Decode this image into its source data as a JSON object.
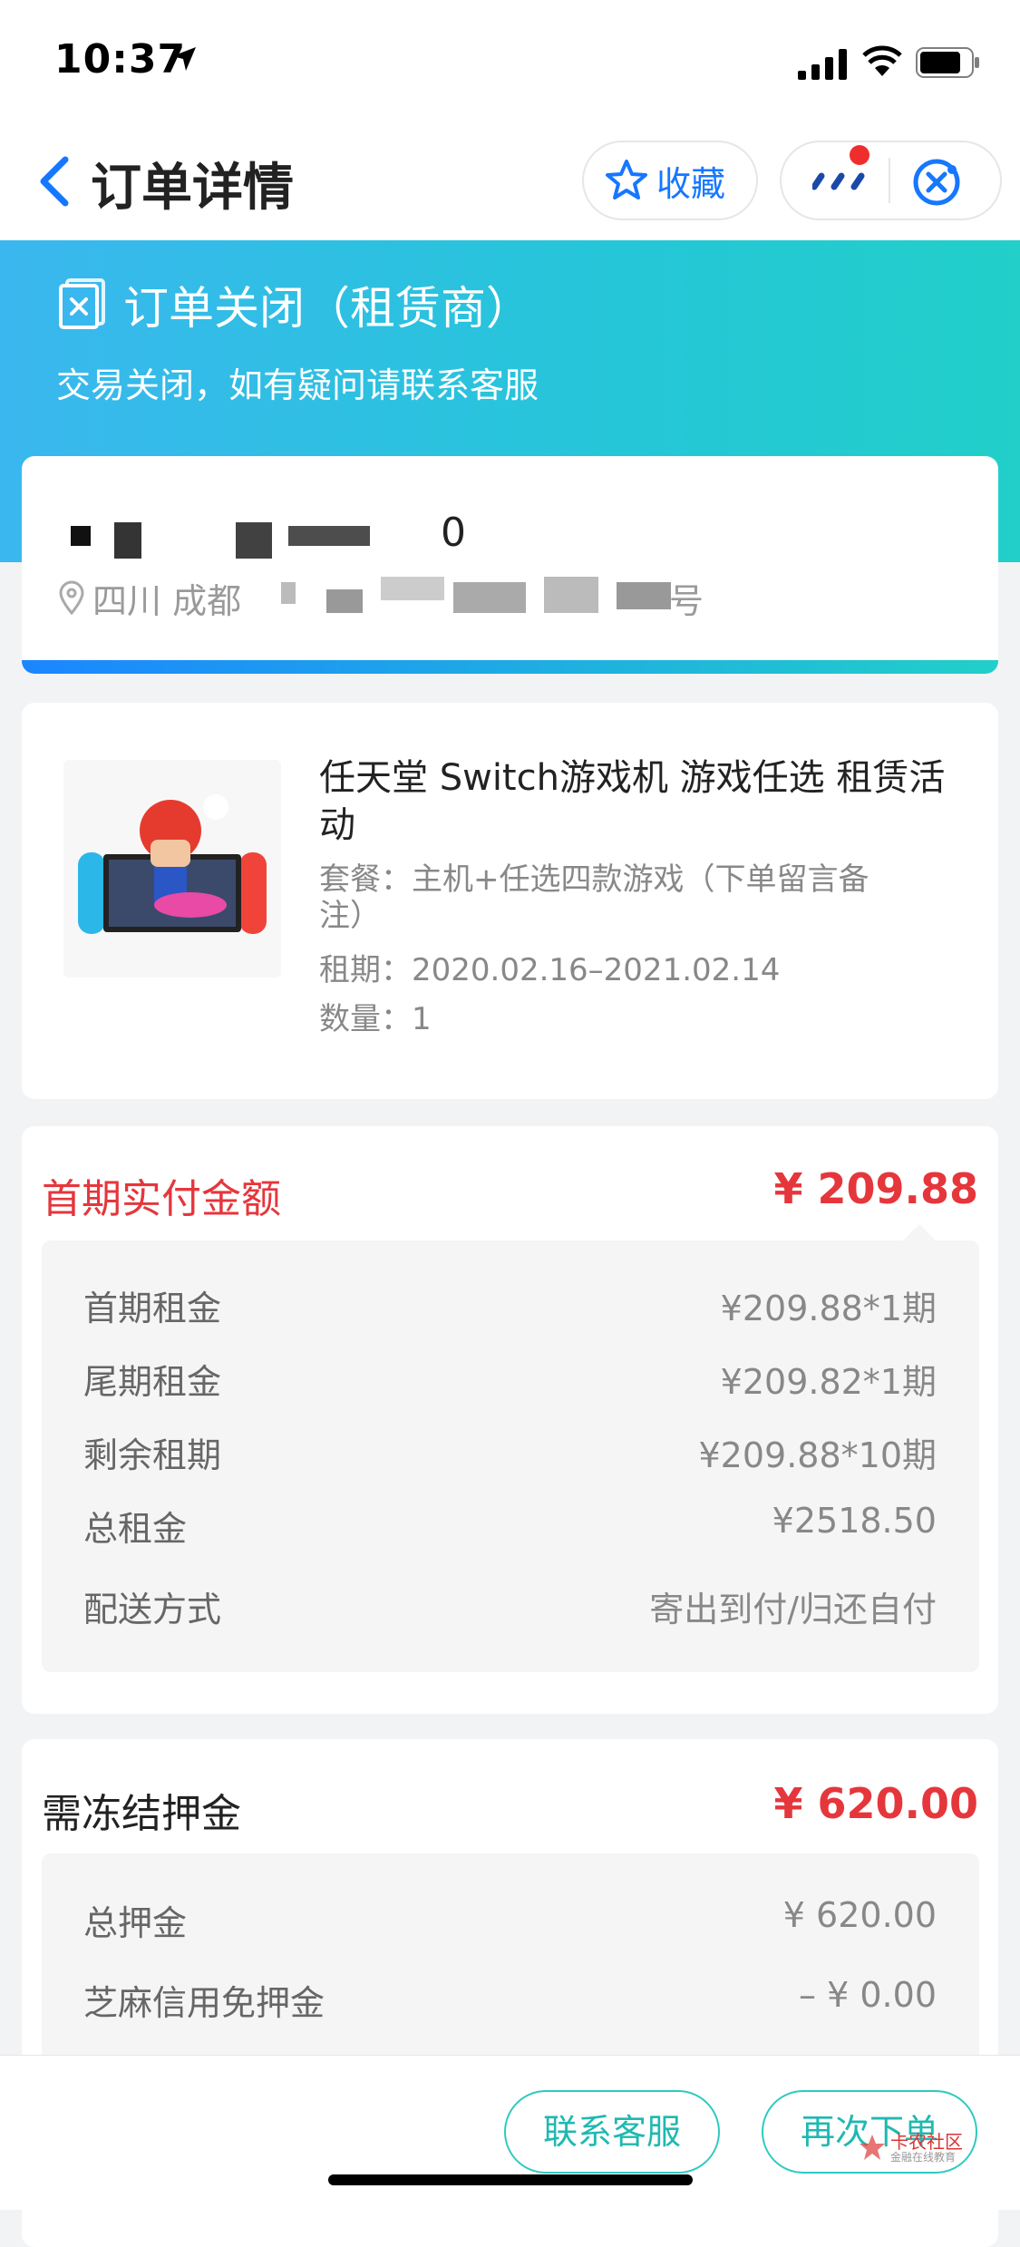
{
  "status_bar": {
    "time": "10:37"
  },
  "nav": {
    "title": "订单详情",
    "favorite_label": "收藏"
  },
  "banner": {
    "title": "订单关闭（租赁商）",
    "subtitle": "交易关闭，如有疑问请联系客服"
  },
  "address": {
    "name_suffix": "0",
    "region": "四川 成都",
    "tail": "号"
  },
  "product": {
    "title": "任天堂 Switch游戏机 游戏任选 租赁活动",
    "package": "套餐：主机+任选四款游戏（下单留言备注）",
    "period": "租期：2020.02.16–2021.02.14",
    "quantity": "数量：1"
  },
  "payment": {
    "label": "首期实付金额",
    "value": "¥ 209.88",
    "rows": [
      {
        "label": "首期租金",
        "value": "¥209.88*1期"
      },
      {
        "label": "尾期租金",
        "value": "¥209.82*1期"
      },
      {
        "label": "剩余租期",
        "value": "¥209.88*10期"
      },
      {
        "label": "总租金",
        "value": "¥2518.50"
      },
      {
        "label": "配送方式",
        "value": "寄出到付/归还自付"
      }
    ]
  },
  "deposit": {
    "label": "需冻结押金",
    "value": "¥ 620.00",
    "rows": [
      {
        "label": "总押金",
        "value": "¥ 620.00"
      },
      {
        "label": "芝麻信用免押金",
        "value": "– ¥ 0.00"
      }
    ]
  },
  "actions": {
    "contact_label": "联系客服",
    "reorder_label": "再次下单"
  },
  "watermark": {
    "text": "卡农社区",
    "sub": "金融在线教育"
  },
  "colors": {
    "accent": "#1677ff",
    "price": "#e5363c",
    "teal": "#22cfc9"
  }
}
